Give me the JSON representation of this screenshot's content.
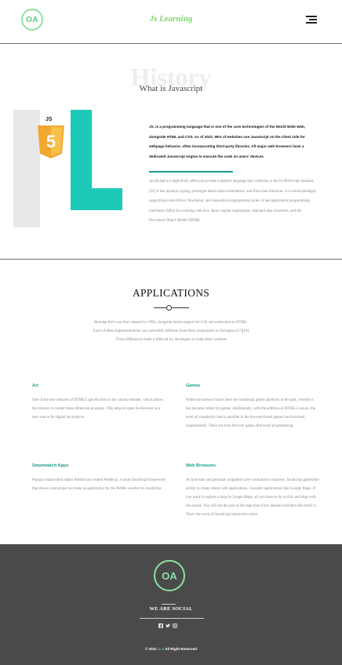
{
  "header": {
    "logo_text": "OA",
    "brand": "Js Learning",
    "menu_icon": "hamburger-menu-icon"
  },
  "history": {
    "background_title": "History",
    "subtitle": "What is Javascript",
    "badge_label": "JS",
    "badge_glyph": "5",
    "bold_paragraph": "JS, is a programming language that is one of the core technologies of the World Wide Web, alongside HTML and CSS. As of 2022, 98% of websites use JavaScript on the client side for webpage behavior, often incorporating third-party libraries. All major web browsers have a dedicated JavaScript engine to execute the code on users' devices.",
    "paragraph": "JavaScript is a high-level, often just-in-time compiled language that conforms to the ECMAScript standard.[10] It has dynamic typing, prototype-based object-orientation, and first-class functions. It is multi-paradigm, supporting event-driven, functional, and imperative programming styles. It has application programming interfaces (APIs) for working with text, dates, regular expressions, standard data structures, and the Document Object Model (DOM)."
  },
  "applications": {
    "title": "APPLICATIONS",
    "intro": "Brendan Eich was first released in 1996, alongside initial support for CSS and extensions to HTML. Each of these implementations was noticeably different from their counterparts in Navigator.[17][18] These differences made it difficult for developers to make their websites",
    "cards": [
      {
        "title": "Art",
        "body": "One of the new features of HTML5 specification is the canvas element, which allows the browser to render three-dimensional spaces. This helps to open the browser as a new source for digital art projects."
      },
      {
        "title": "Games",
        "body": "While the browser hasn't been the traditional games platform in the past, recently it has become robust for games. Additionally, with the addition of HTML5 canvas, the level of complexity that is possible in the browser-based games has increased exponentially. There are even browser games that teach programming."
      },
      {
        "title": "Smartwatch Apps",
        "body": "Popular smartwatch maker Pebble has created Pebble.js, a small JavaScript framework that allows a developer to create an application for the Pebble watches in JavaScript."
      },
      {
        "title": "Web Browsers",
        "body": "As browsers and personal computers have continued to improve, JavaScript gained the ability to create robust web applications. Consider applications like Google Maps. If you want to explore a map in Google Maps, all you have to do is click and drag with the mouse. You will see the part of the map that is less detailed and then fills itself in. That's the work of JavaScript behind the scene."
      }
    ]
  },
  "footer": {
    "logo_text": "OA",
    "social_heading": "WE ARE SOCIAL",
    "social_icons": [
      "facebook-icon",
      "twitter-icon",
      "instagram-icon"
    ],
    "copyright_prefix": "© 2021",
    "copyright_brand": "O.A",
    "copyright_suffix": "All Right Reserved"
  },
  "colors": {
    "accent_teal": "#1dc9b7",
    "accent_green": "#7fd66a",
    "footer_bg": "#4a4a4a"
  }
}
